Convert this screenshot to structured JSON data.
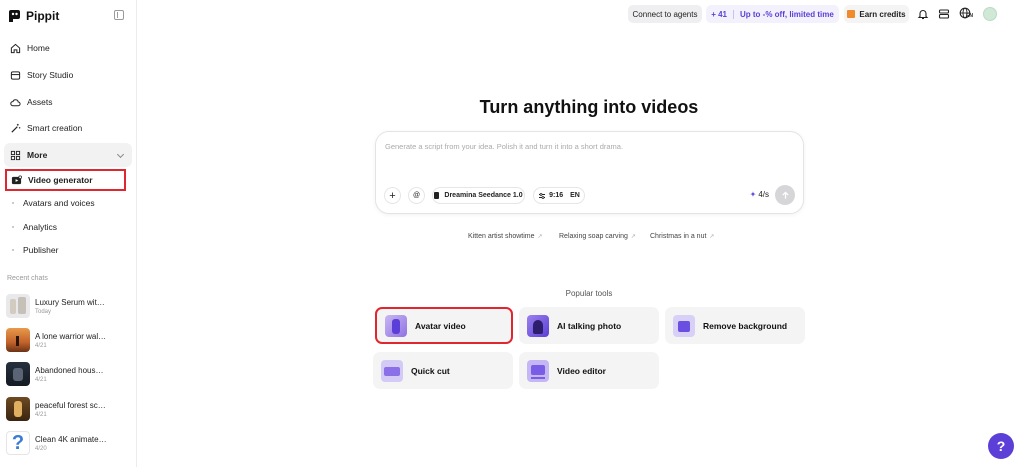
{
  "app": {
    "name": "Pippit"
  },
  "sidebar": {
    "nav": [
      {
        "label": "Home",
        "icon": "home-icon"
      },
      {
        "label": "Story Studio",
        "icon": "story-icon"
      },
      {
        "label": "Assets",
        "icon": "cloud-icon"
      },
      {
        "label": "Smart creation",
        "icon": "magic-wand-icon"
      },
      {
        "label": "More",
        "icon": "grid-icon"
      }
    ],
    "active_item": {
      "label": "Video generator",
      "icon": "video-generator-icon"
    },
    "sub_items": [
      "Avatars and voices",
      "Analytics",
      "Publisher"
    ],
    "recent_label": "Recent chats",
    "recent_chats": [
      {
        "title": "Luxury Serum with ...",
        "date": "Today"
      },
      {
        "title": "A lone warrior walk...",
        "date": "4/21"
      },
      {
        "title": "Abandoned house,...",
        "date": "4/21"
      },
      {
        "title": "peaceful forest scene",
        "date": "4/21"
      },
      {
        "title": "Clean 4K animated...",
        "date": "4/20"
      }
    ]
  },
  "topbar": {
    "connect_label": "Connect to agents",
    "credits_value": "+ 41",
    "promo_text": "Up to -% off, limited time",
    "earn_label": "Earn credits",
    "language": "EN"
  },
  "main": {
    "headline": "Turn anything into videos",
    "prompt": {
      "placeholder": "Generate a script from your idea. Polish it and turn it into a short drama.",
      "plus_label": "+",
      "at_label": "@",
      "model_label": "Dreamina Seedance 1.0",
      "ratio_label": "9:16",
      "lang_label": "EN",
      "cost": "4/s",
      "send_icon": "arrow-up-icon"
    },
    "suggestions": [
      "Kitten artist showtime",
      "Relaxing soap carving",
      "Christmas in a nut"
    ],
    "popular_label": "Popular tools",
    "tools": [
      {
        "label": "Avatar video"
      },
      {
        "label": "AI talking photo"
      },
      {
        "label": "Remove background"
      },
      {
        "label": "Quick cut"
      },
      {
        "label": "Video editor"
      }
    ]
  },
  "help_label": "?",
  "colors": {
    "accent": "#5b3fd6",
    "highlight_border": "#e0262e"
  }
}
